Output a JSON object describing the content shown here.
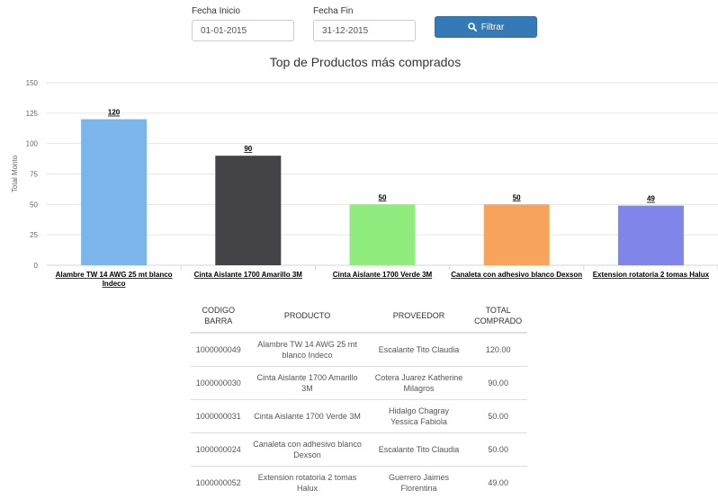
{
  "filters": {
    "start_label": "Fecha Inicio",
    "start_value": "01-01-2015",
    "end_label": "Fecha Fin",
    "end_value": "31-12-2015",
    "filter_button": "Filtrar",
    "filter_icon": "search-icon"
  },
  "chart_data": {
    "type": "bar",
    "title": "Top de Productos más comprados",
    "ylabel": "Total Monto",
    "xlabel": "",
    "ylim": [
      0,
      150
    ],
    "yticks": [
      0,
      25,
      50,
      75,
      100,
      125,
      150
    ],
    "grid": true,
    "categories": [
      [
        "Alambre TW 14 AWG 25 mt blanco",
        "Indeco"
      ],
      [
        "Cinta Aislante 1700 Amarillo 3M"
      ],
      [
        "Cinta Aislante 1700 Verde 3M"
      ],
      [
        "Canaleta con adhesivo blanco Dexson"
      ],
      [
        "Extension rotatoria 2 tomas Halux"
      ]
    ],
    "values": [
      120,
      90,
      50,
      50,
      49
    ],
    "colors": [
      "#7cb5ec",
      "#434348",
      "#90ed7d",
      "#f7a35c",
      "#8085e9"
    ]
  },
  "table": {
    "headers": [
      [
        "CODIGO",
        "BARRA"
      ],
      [
        "PRODUCTO"
      ],
      [
        "PROVEEDOR"
      ],
      [
        "TOTAL",
        "COMPRADO"
      ]
    ],
    "rows": [
      [
        [
          "1000000049"
        ],
        [
          "Alambre TW 14 AWG 25 mt",
          "blanco Indeco"
        ],
        [
          "Escalante Tito Claudia"
        ],
        [
          "120.00"
        ]
      ],
      [
        [
          "1000000030"
        ],
        [
          "Cinta Aislante 1700 Amarillo",
          "3M"
        ],
        [
          "Cotera Juarez Katherine",
          "Milagros"
        ],
        [
          "90.00"
        ]
      ],
      [
        [
          "1000000031"
        ],
        [
          "Cinta Aislante 1700 Verde 3M"
        ],
        [
          "Hidalgo Chagray",
          "Yessica Fabiola"
        ],
        [
          "50.00"
        ]
      ],
      [
        [
          "1000000024"
        ],
        [
          "Canaleta con adhesivo blanco",
          "Dexson"
        ],
        [
          "Escalante Tito Claudia"
        ],
        [
          "50.00"
        ]
      ],
      [
        [
          "1000000052"
        ],
        [
          "Extension rotatoria 2 tomas",
          "Halux"
        ],
        [
          "Guerrero Jaimes",
          "Florentina"
        ],
        [
          "49.00"
        ]
      ]
    ]
  }
}
